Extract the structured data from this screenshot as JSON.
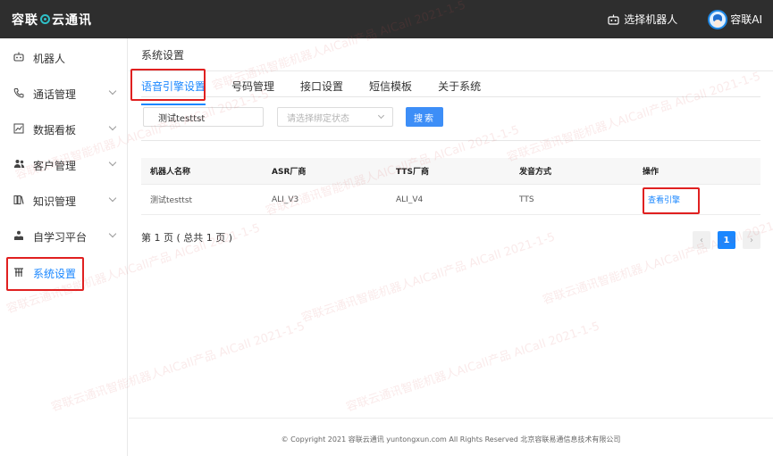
{
  "header": {
    "logo": "容联",
    "logo_suffix": "云通讯",
    "robot_select_label": "选择机器人",
    "user_name": "容联AI"
  },
  "sidebar": {
    "items": [
      {
        "label": "机器人",
        "icon": "robot-icon",
        "has_children": false
      },
      {
        "label": "通话管理",
        "icon": "phone-icon",
        "has_children": true
      },
      {
        "label": "数据看板",
        "icon": "chart-icon",
        "has_children": true
      },
      {
        "label": "客户管理",
        "icon": "users-icon",
        "has_children": true
      },
      {
        "label": "知识管理",
        "icon": "knowledge-icon",
        "has_children": true
      },
      {
        "label": "自学习平台",
        "icon": "learning-icon",
        "has_children": true
      },
      {
        "label": "系统设置",
        "icon": "settings-icon",
        "has_children": false,
        "active": true
      }
    ]
  },
  "breadcrumb": "系统设置",
  "tabs": [
    {
      "label": "语音引擎设置",
      "active": true
    },
    {
      "label": "号码管理"
    },
    {
      "label": "接口设置"
    },
    {
      "label": "短信模板"
    },
    {
      "label": "关于系统"
    }
  ],
  "filters": {
    "name_value": "测试testtst",
    "status_placeholder": "请选择绑定状态",
    "search_label": "搜索"
  },
  "table": {
    "headers": [
      "机器人名称",
      "ASR厂商",
      "TTS厂商",
      "发音方式",
      "操作"
    ],
    "rows": [
      {
        "name": "测试testtst",
        "asr": "ALI_V3",
        "tts": "ALI_V4",
        "voice": "TTS",
        "action": "查看引擎"
      }
    ]
  },
  "pagination": {
    "info": "第 1 页 ( 总共 1 页 )",
    "current": "1",
    "prev": "‹",
    "next": "›"
  },
  "footer": "© Copyright 2021   容联云通讯    yuntongxun.com    All Rights Reserved  北京容联易通信息技术有限公司",
  "watermark": "容联云通讯智能机器人AICall产品  AICall  2021-1-5",
  "colors": {
    "accent": "#1a87ff",
    "topbar": "#2e2e2e",
    "highlight_box": "#e02020"
  }
}
